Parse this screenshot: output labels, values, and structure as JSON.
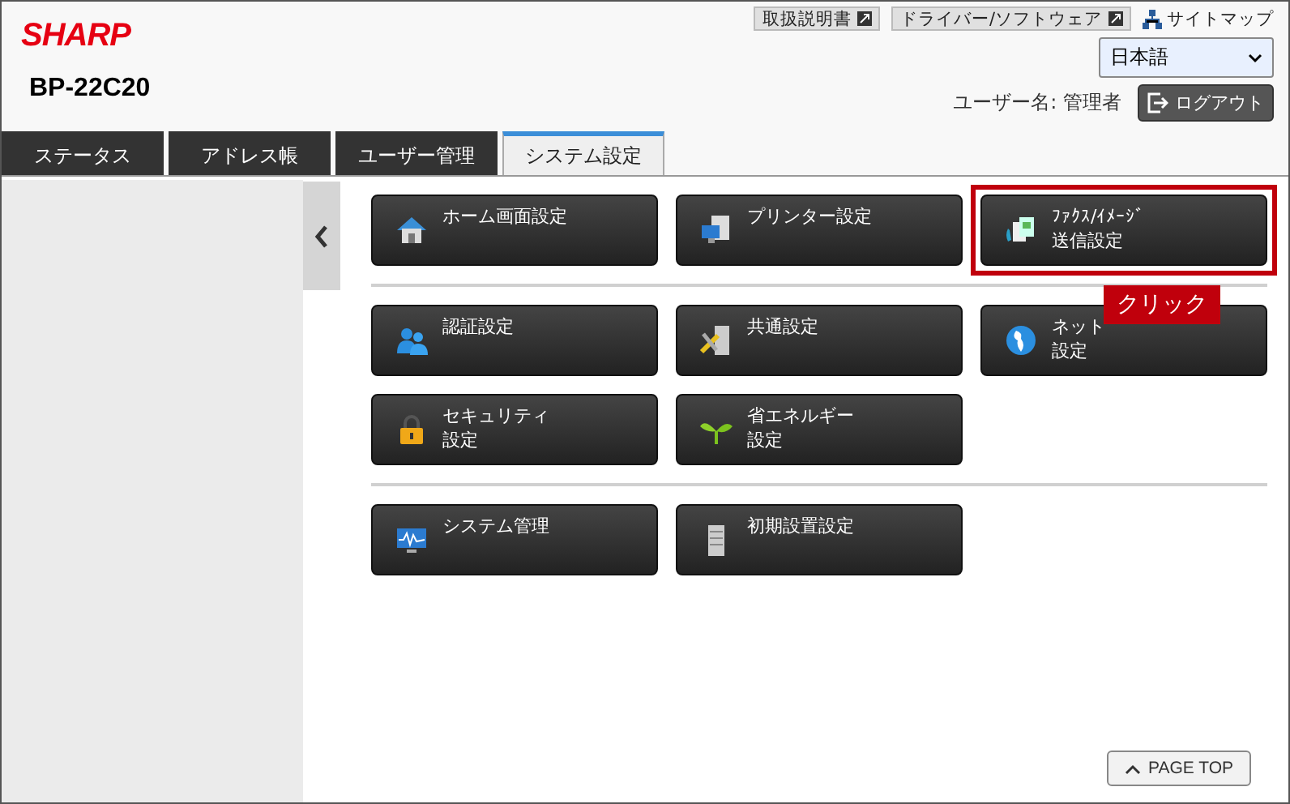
{
  "header": {
    "brand": "SHARP",
    "model": "BP-22C20",
    "links": [
      {
        "kind": "doc",
        "label": "取扱説明書"
      },
      {
        "kind": "doc",
        "label": "ドライバー/ソフトウェア"
      },
      {
        "kind": "sitemap",
        "label": "サイトマップ"
      }
    ],
    "language": "日本語",
    "user_label": "ユーザー名: 管理者",
    "logout": "ログアウト"
  },
  "tabs": [
    {
      "label": "ステータス",
      "selected": false
    },
    {
      "label": "アドレス帳",
      "selected": false
    },
    {
      "label": "ユーザー管理",
      "selected": false
    },
    {
      "label": "システム設定",
      "selected": true
    }
  ],
  "groups": [
    {
      "buttons": [
        {
          "kind": "home",
          "lines": [
            "ホーム画面設定"
          ],
          "highlighted": false
        },
        {
          "kind": "printer",
          "lines": [
            "プリンター設定"
          ],
          "highlighted": false
        },
        {
          "kind": "fax",
          "lines": [
            "ﾌｧｸｽ/ｲﾒｰｼﾞ",
            "送信設定"
          ],
          "highlighted": true
        }
      ]
    },
    {
      "buttons": [
        {
          "kind": "users",
          "lines": [
            "認証設定"
          ],
          "highlighted": false
        },
        {
          "kind": "tools",
          "lines": [
            "共通設定"
          ],
          "highlighted": false
        },
        {
          "kind": "globe",
          "lines": [
            "ネット",
            "設定"
          ],
          "highlighted": false
        },
        {
          "kind": "lock",
          "lines": [
            "セキュリティ",
            "設定"
          ],
          "highlighted": false
        },
        {
          "kind": "leaf",
          "lines": [
            "省エネルギー",
            "設定"
          ],
          "highlighted": false
        }
      ]
    },
    {
      "buttons": [
        {
          "kind": "monitor",
          "lines": [
            "システム管理"
          ],
          "highlighted": false
        },
        {
          "kind": "server",
          "lines": [
            "初期設置設定"
          ],
          "highlighted": false
        }
      ]
    }
  ],
  "callout": "クリック",
  "page_top": "PAGE TOP"
}
